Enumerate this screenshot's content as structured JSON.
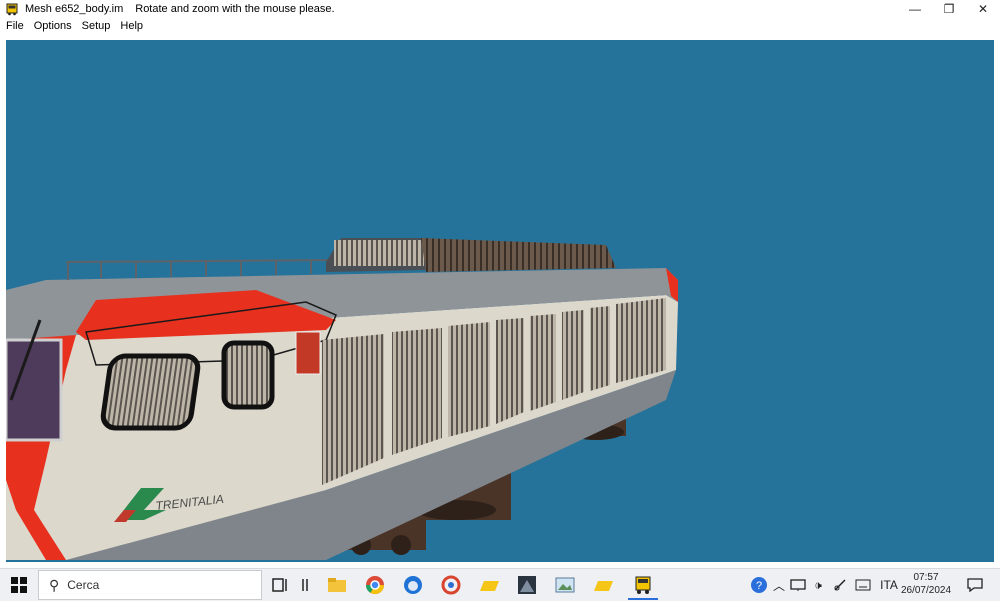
{
  "window": {
    "title": "Mesh e652_body.im",
    "hint": "Rotate and zoom with the mouse please.",
    "controls": {
      "minimize": "—",
      "restore": "❐",
      "close": "✕"
    }
  },
  "menu": {
    "items": [
      {
        "label": "File"
      },
      {
        "label": "Options"
      },
      {
        "label": "Setup"
      },
      {
        "label": "Help"
      }
    ]
  },
  "viewport": {
    "background": "#25739a",
    "livery_text": "TRENITALIA"
  },
  "taskbar": {
    "search_placeholder": "Cerca",
    "language": "ITA",
    "time": "07:57",
    "date": "26/07/2024",
    "pinned_icons": [
      "task-view-icon",
      "file-explorer-icon",
      "chrome-icon",
      "thunderbird-icon",
      "ccleaner-icon",
      "folder-yellow-icon",
      "mountain-app-icon",
      "image-viewer-icon",
      "folder-yellow-icon-2",
      "train-app-icon"
    ]
  },
  "colors": {
    "accent_red": "#e8301e",
    "body_cream": "#dcd8cc",
    "roof_gray": "#8f9499",
    "taskbar_bg": "#eef0f3"
  }
}
